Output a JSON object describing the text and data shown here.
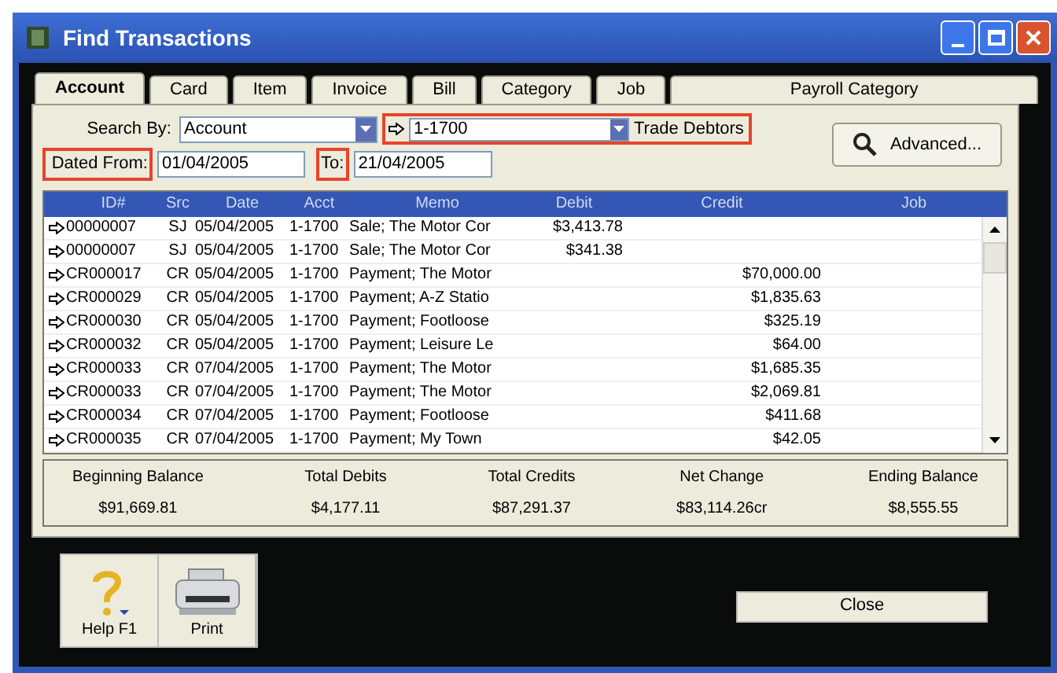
{
  "window": {
    "title": "Find Transactions"
  },
  "tabs": [
    {
      "label": "Account",
      "selected": true
    },
    {
      "label": "Card",
      "selected": false
    },
    {
      "label": "Item",
      "selected": false
    },
    {
      "label": "Invoice",
      "selected": false
    },
    {
      "label": "Bill",
      "selected": false
    },
    {
      "label": "Category",
      "selected": false
    },
    {
      "label": "Job",
      "selected": false
    },
    {
      "label": "Payroll Category",
      "selected": false
    }
  ],
  "search": {
    "label": "Search By:",
    "value": "Account",
    "account": "1-1700",
    "account_name": "Trade Debtors",
    "highlighted": true
  },
  "dates": {
    "from_label": "Dated From:",
    "from_highlighted": true,
    "from": "01/04/2005",
    "to_label": "To:",
    "to_highlighted": true,
    "to": "21/04/2005"
  },
  "advanced_button": "Advanced...",
  "table": {
    "columns": [
      "ID#",
      "Src",
      "Date",
      "Acct",
      "Memo",
      "Debit",
      "Credit",
      "Job"
    ],
    "rows": [
      [
        "00000007",
        "SJ",
        "05/04/2005",
        "1-1700",
        "Sale; The Motor Cor",
        "$3,413.78",
        "",
        ""
      ],
      [
        "00000007",
        "SJ",
        "05/04/2005",
        "1-1700",
        "Sale; The Motor Cor",
        "$341.38",
        "",
        ""
      ],
      [
        "CR000017",
        "CR",
        "05/04/2005",
        "1-1700",
        "Payment; The Motor",
        "",
        "$70,000.00",
        ""
      ],
      [
        "CR000029",
        "CR",
        "05/04/2005",
        "1-1700",
        "Payment; A-Z Statio",
        "",
        "$1,835.63",
        ""
      ],
      [
        "CR000030",
        "CR",
        "05/04/2005",
        "1-1700",
        "Payment; Footloose",
        "",
        "$325.19",
        ""
      ],
      [
        "CR000032",
        "CR",
        "05/04/2005",
        "1-1700",
        "Payment; Leisure Le",
        "",
        "$64.00",
        ""
      ],
      [
        "CR000033",
        "CR",
        "07/04/2005",
        "1-1700",
        "Payment; The Motor",
        "",
        "$1,685.35",
        ""
      ],
      [
        "CR000033",
        "CR",
        "07/04/2005",
        "1-1700",
        "Payment; The Motor",
        "",
        "$2,069.81",
        ""
      ],
      [
        "CR000034",
        "CR",
        "07/04/2005",
        "1-1700",
        "Payment; Footloose",
        "",
        "$411.68",
        ""
      ],
      [
        "CR000035",
        "CR",
        "07/04/2005",
        "1-1700",
        "Payment; My Town",
        "",
        "$42.05",
        ""
      ]
    ]
  },
  "totals": [
    {
      "label": "Beginning Balance",
      "value": "$91,669.81"
    },
    {
      "label": "Total Debits",
      "value": "$4,177.11"
    },
    {
      "label": "Total Credits",
      "value": "$87,291.37"
    },
    {
      "label": "Net Change",
      "value": "$83,114.26cr"
    },
    {
      "label": "Ending Balance",
      "value": "$8,555.55"
    }
  ],
  "toolbar": [
    {
      "kind": "help",
      "label": "Help F1"
    },
    {
      "kind": "print",
      "label": "Print"
    }
  ],
  "close_button": "Close"
}
